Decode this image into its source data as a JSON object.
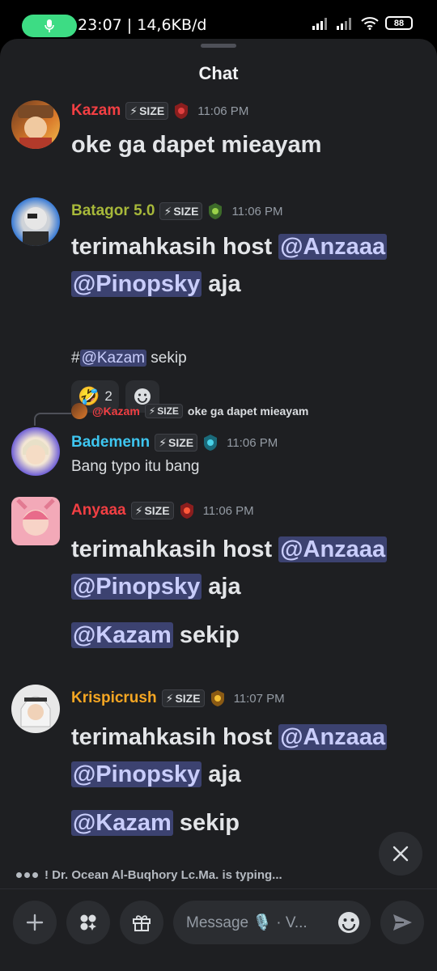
{
  "status": {
    "time_speed": "23:07 | 14,6KB/d",
    "battery": "88"
  },
  "header": {
    "title": "Chat"
  },
  "tag_label": "SIZE",
  "messages": [
    {
      "user": "Kazam",
      "color": "#f23f43",
      "time": "11:06 PM",
      "text": "oke ga dapet mieayam"
    },
    {
      "user": "Batagor 5.0",
      "color": "#a7b83a",
      "time": "11:06 PM",
      "text_part1": "terimahkasih host ",
      "mention1": "@Anzaaa",
      "mention2": "@Pinopsky",
      "text_part2": " aja",
      "sub_prefix": "#",
      "sub_mention": "@Kazam",
      "sub_text": " sekip",
      "reaction_count": "2"
    },
    {
      "user": "Bademenn",
      "color": "#3ec6f0",
      "time": "11:06 PM",
      "text": "Bang typo itu bang",
      "reply_user": "@Kazam",
      "reply_text": "oke ga dapet mieayam"
    },
    {
      "user": "Anyaaa",
      "color": "#f23f43",
      "time": "11:06 PM",
      "text_part1": "terimahkasih host ",
      "mention1": "@Anzaaa",
      "mention2": "@Pinopsky",
      "text_part2": " aja",
      "mention3": "@Kazam",
      "text_part3": " sekip"
    },
    {
      "user": "Krispicrush",
      "color": "#f5a623",
      "time": "11:07 PM",
      "text_part1": "terimahkasih host ",
      "mention1": "@Anzaaa",
      "mention2": "@Pinopsky",
      "text_part2": " aja",
      "mention3": "@Kazam",
      "text_part3": " sekip"
    }
  ],
  "typing": "! Dr. Ocean Al-Buqhory Lc.Ma. is typing...",
  "composer": {
    "placeholder": "Message 🎙️ · V..."
  }
}
